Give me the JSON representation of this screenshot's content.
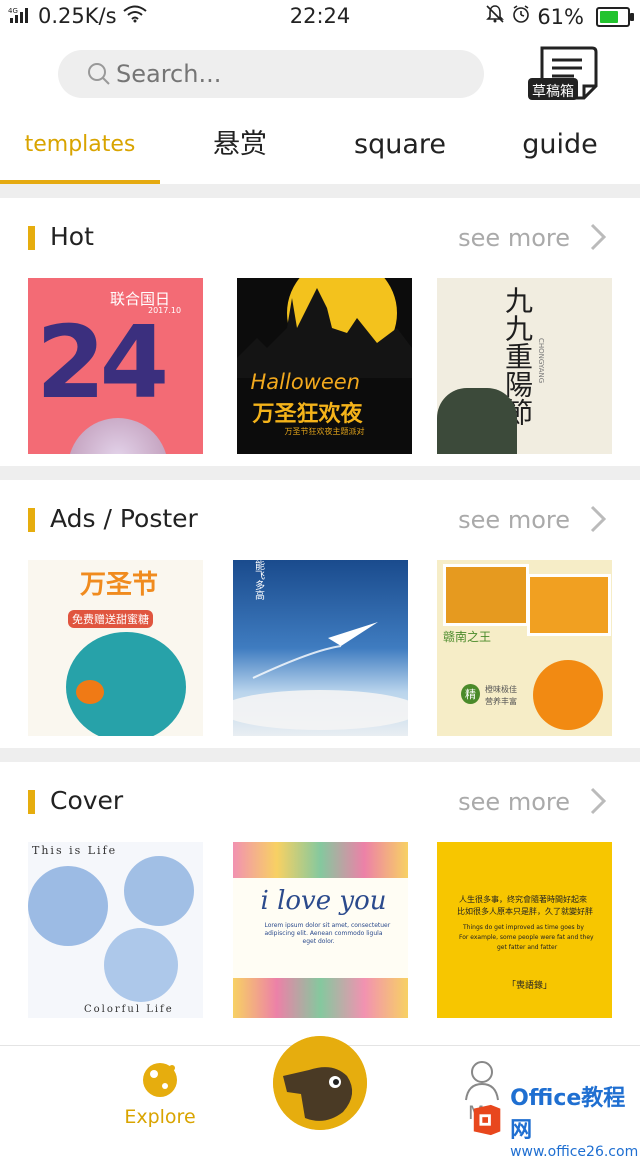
{
  "status_bar": {
    "network": "4G",
    "speed": "0.25K/s",
    "time": "22:24",
    "battery": "61%",
    "battery_level": 0.61
  },
  "search": {
    "placeholder": "Search..."
  },
  "drafts": {
    "label": "草稿箱"
  },
  "tabs": [
    {
      "label": "templates",
      "active": true
    },
    {
      "label": "悬赏",
      "active": false
    },
    {
      "label": "square",
      "active": false
    },
    {
      "label": "guide",
      "active": false
    }
  ],
  "sections": [
    {
      "title": "Hot",
      "more": "see more",
      "items": [
        {
          "name": "un-day-24",
          "texts": [
            "联合国日",
            "2017.10",
            "24"
          ]
        },
        {
          "name": "halloween",
          "texts": [
            "Halloween",
            "万圣狂欢夜",
            "万圣节狂欢夜主题派对"
          ]
        },
        {
          "name": "chongyang",
          "texts": [
            "九九重陽節",
            "CHONGYANG"
          ]
        }
      ]
    },
    {
      "title": "Ads / Poster",
      "more": "see more",
      "items": [
        {
          "name": "wanshengjie",
          "texts": [
            "万圣节",
            "免费赠送甜蜜糖"
          ]
        },
        {
          "name": "paper-plane",
          "texts": [
            "能飞多高"
          ]
        },
        {
          "name": "oranges",
          "texts": [
            "赣南之王",
            "精",
            "橙味极佳",
            "营养丰富"
          ]
        }
      ]
    },
    {
      "title": "Cover",
      "more": "see more",
      "items": [
        {
          "name": "this-is-life",
          "texts": [
            "This is Life",
            "Colorful Life"
          ]
        },
        {
          "name": "i-love-you",
          "texts": [
            "i love you",
            "Lorem ipsum dolor sit amet, consectetuer",
            "adipiscing elit. Aenean commodo ligula",
            "eget dolor."
          ]
        },
        {
          "name": "quote-yellow",
          "texts": [
            "人生很多事，终究會隨著時間好起來",
            "比如很多人原本只是胖，久了就變好胖",
            "Things do get improved as time goes by",
            "For example, some people were fat and they",
            "get fatter and fatter",
            "「喪語錄」"
          ]
        }
      ]
    }
  ],
  "bottom_nav": {
    "explore": "Explore",
    "me": "Me"
  },
  "watermark": {
    "name": "Office教程网",
    "url": "www.office26.com"
  },
  "colors": {
    "accent": "#e6ad0e",
    "accent_text": "#d9a400"
  }
}
